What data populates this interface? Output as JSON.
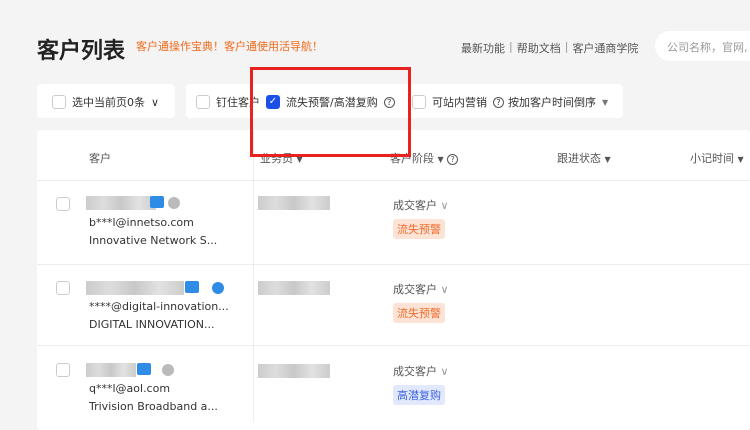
{
  "header": {
    "title": "客户列表",
    "promo": "客户通操作宝典！客户通使用活导航！",
    "links": [
      "最新功能",
      "帮助文档",
      "客户通商学院"
    ],
    "search_placeholder": "公司名称，官网,"
  },
  "toolbar": {
    "select_page": "选中当前页0条",
    "pin": "钉住客户",
    "churn_filter": "流失预警/高潜复购",
    "churn_checked": true,
    "site_marketing": "可站内营销",
    "sort": "按加客户时间倒序"
  },
  "table": {
    "columns": [
      "客户",
      "业务员",
      "客户阶段",
      "跟进状态",
      "小记时间"
    ],
    "rows": [
      {
        "email": "b***l@innetso.com",
        "company": "Innovative Network S...",
        "stage": "成交客户",
        "tag": "流失预警",
        "tag_type": "lost"
      },
      {
        "email": "****@digital-innovation...",
        "company": "DIGITAL INNOVATION...",
        "stage": "成交客户",
        "tag": "流失预警",
        "tag_type": "lost"
      },
      {
        "email": "q***l@aol.com",
        "company": "Trivision Broadband a...",
        "stage": "成交客户",
        "tag": "高潜复购",
        "tag_type": "rebuy"
      }
    ]
  },
  "colors": {
    "accent": "#f06a1b",
    "highlight": "#e8231f",
    "checkbox": "#1a4fe8"
  }
}
